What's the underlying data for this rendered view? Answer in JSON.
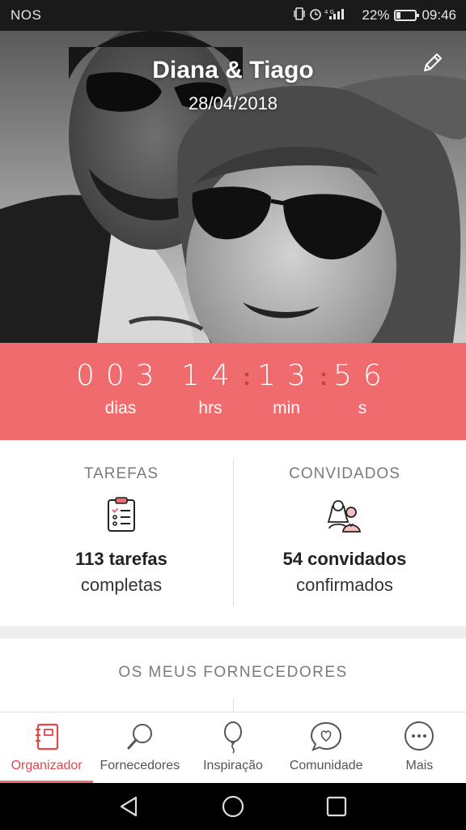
{
  "status_bar": {
    "carrier": "NOS",
    "icons": "vibrate, alarm, signal",
    "battery_percent": "22%",
    "battery_level": 0.22,
    "time": "09:46"
  },
  "hero": {
    "couple_name": "Diana & Tiago",
    "wedding_date": "28/04/2018",
    "edit_icon": "pencil-icon"
  },
  "countdown": {
    "days": "003",
    "hours": "14",
    "minutes": "13",
    "seconds": "56",
    "days_label": "dias",
    "hours_label": "hrs",
    "minutes_label": "min",
    "seconds_label": "s",
    "separator": ":"
  },
  "stats": {
    "tasks": {
      "title": "TAREFAS",
      "icon": "checklist-clipboard-icon",
      "count": "113 tarefas",
      "sub": "completas"
    },
    "guests": {
      "title": "CONVIDADOS",
      "icon": "couple-guests-icon",
      "count": "54 convidados",
      "sub": "confirmados"
    }
  },
  "providers": {
    "title": "OS MEUS FORNECEDORES"
  },
  "tabs": [
    {
      "label": "Organizador",
      "icon": "planner-book-icon",
      "active": true
    },
    {
      "label": "Fornecedores",
      "icon": "magnifier-icon",
      "active": false
    },
    {
      "label": "Inspiração",
      "icon": "balloon-icon",
      "active": false
    },
    {
      "label": "Comunidade",
      "icon": "chat-heart-icon",
      "active": false
    },
    {
      "label": "Mais",
      "icon": "more-dots-icon",
      "active": false
    }
  ],
  "colors": {
    "accent": "#f06b6d",
    "accent_dark": "#e0484c",
    "separator": "#b8474a"
  }
}
